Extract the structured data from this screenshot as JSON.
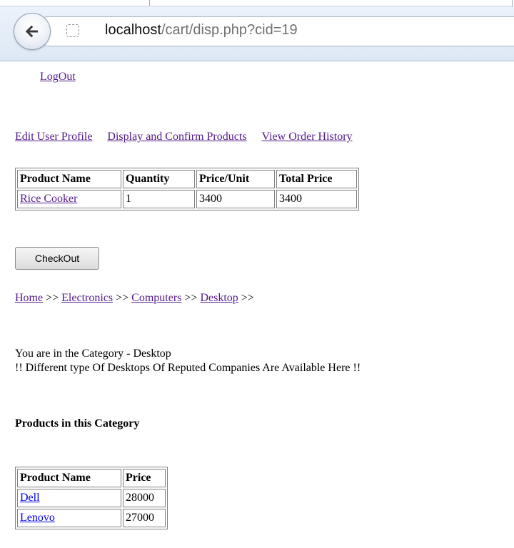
{
  "browser": {
    "url_host": "localhost",
    "url_path": "/cart/disp.php?cid=19"
  },
  "header": {
    "logout_label": "LogOut"
  },
  "nav": {
    "edit_profile": "Edit User Profile",
    "display_confirm": "Display and Confirm Products",
    "order_history": "View Order History"
  },
  "cart": {
    "columns": [
      "Product Name",
      "Quantity",
      "Price/Unit",
      "Total Price"
    ],
    "rows": [
      {
        "product": "Rice Cooker",
        "quantity": "1",
        "price_unit": "3400",
        "total": "3400"
      }
    ]
  },
  "checkout_label": "CheckOut",
  "breadcrumb": {
    "items": [
      "Home",
      "Electronics",
      "Computers",
      "Desktop"
    ],
    "separator": ">>"
  },
  "category": {
    "line1": "You are in the Category - Desktop",
    "line2": "!! Different type Of Desktops Of Reputed Companies Are Available Here !!"
  },
  "products": {
    "heading": "Products in this Category",
    "columns": [
      "Product Name",
      "Price"
    ],
    "rows": [
      {
        "name": "Dell",
        "price": "28000"
      },
      {
        "name": "Lenovo",
        "price": "27000"
      }
    ]
  },
  "colors": {
    "visited_link": "#551a8b",
    "unvisited_link": "#0000ee"
  }
}
